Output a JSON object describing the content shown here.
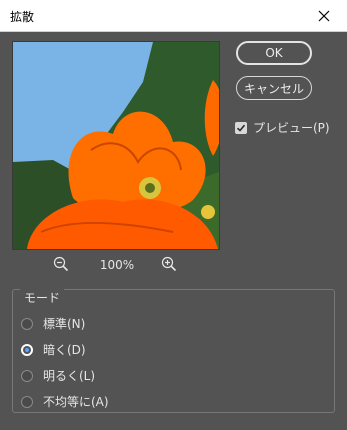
{
  "window": {
    "title": "拡散"
  },
  "buttons": {
    "ok": "OK",
    "cancel": "キャンセル"
  },
  "preview_check": {
    "label": "プレビュー(P)",
    "checked": true
  },
  "zoom": {
    "value": "100%"
  },
  "mode_group": {
    "label": "モード",
    "options": [
      {
        "label": "標準(N)",
        "selected": false
      },
      {
        "label": "暗く(D)",
        "selected": true
      },
      {
        "label": "明るく(L)",
        "selected": false
      },
      {
        "label": "不均等に(A)",
        "selected": false
      }
    ]
  },
  "colors": {
    "dialog_bg": "#535353",
    "titlebar_bg": "#ffffff",
    "accent": "#5aa0ff"
  },
  "icons": [
    "close-icon",
    "zoom-out-icon",
    "zoom-in-icon",
    "checkmark-icon"
  ]
}
